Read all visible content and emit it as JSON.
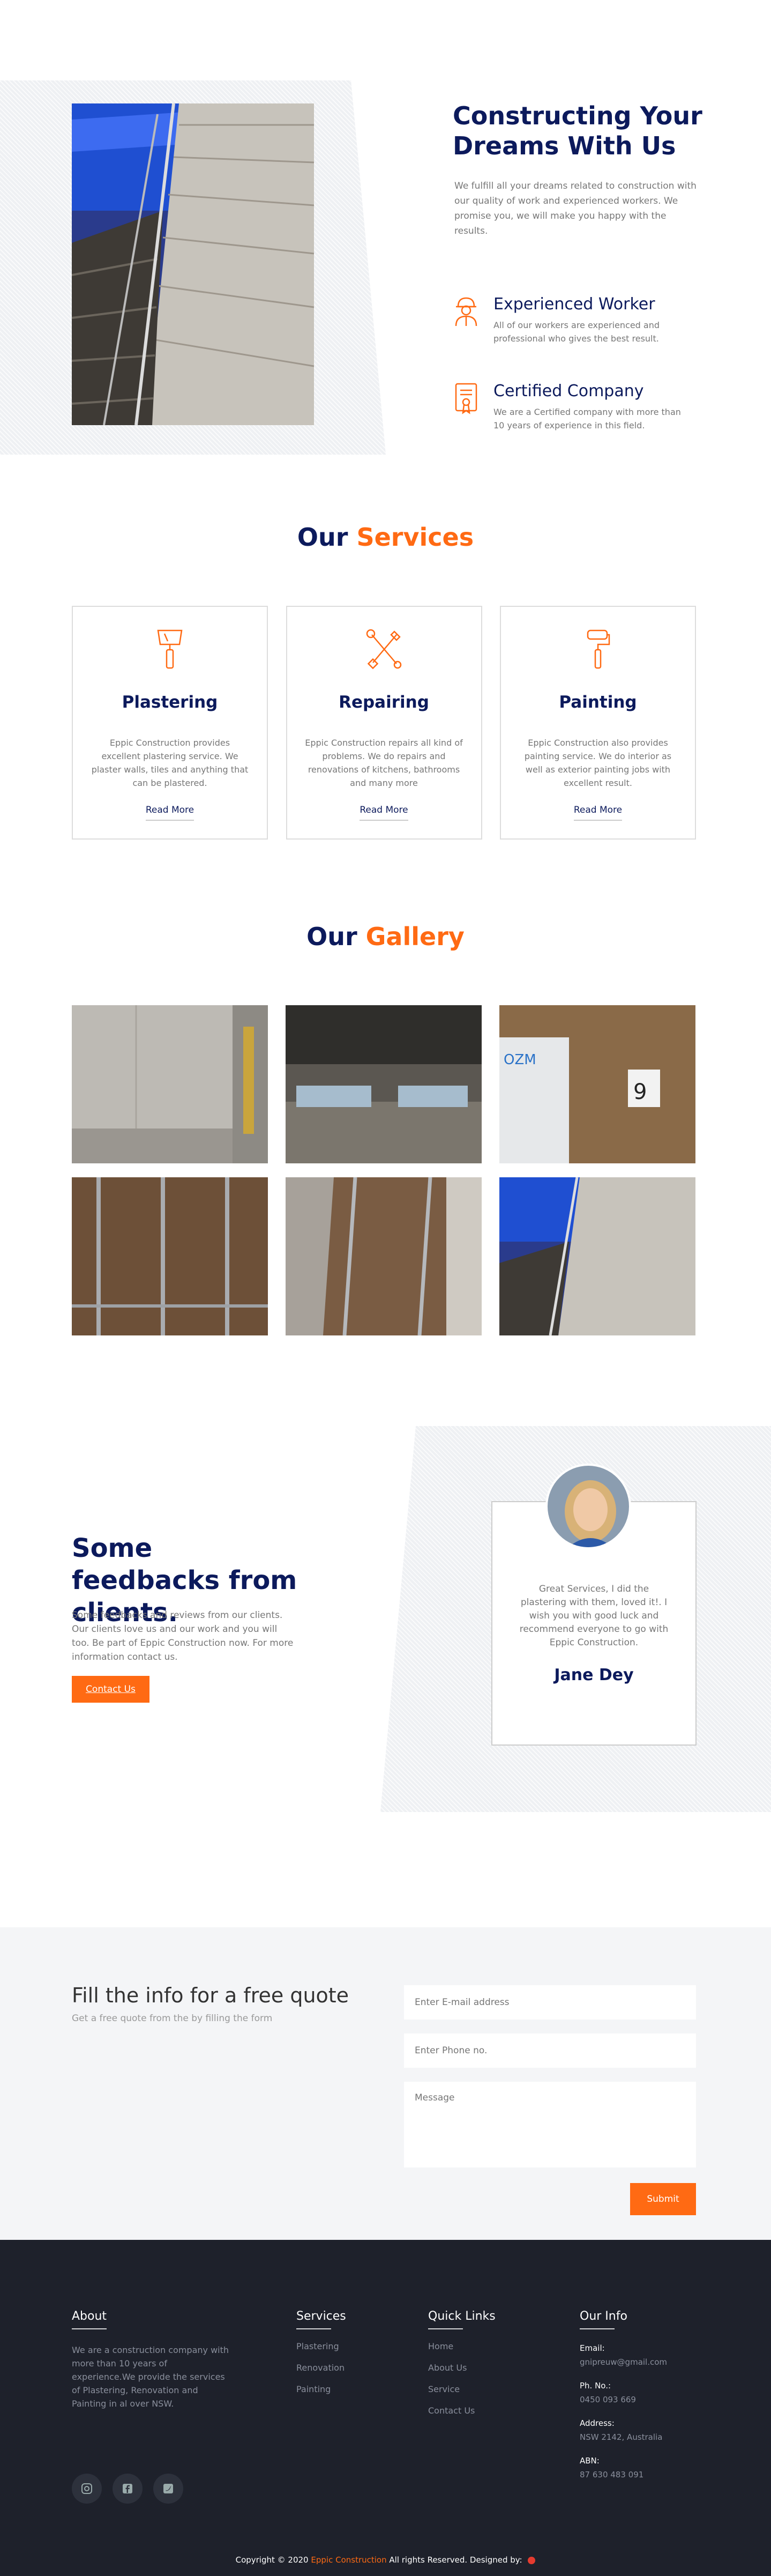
{
  "hero": {
    "title": "Constructing Your Dreams With Us",
    "text": "We fulfill all your dreams related to construction with our quality of work and experienced workers. We promise you, we will make you happy with the results.",
    "features": [
      {
        "icon": "worker-icon",
        "title": "Experienced Worker",
        "text": "All of our workers are experienced and professional who gives the best result."
      },
      {
        "icon": "certificate-icon",
        "title": "Certified Company",
        "text": "We are a Certified company with more than 10 years of experience in this field."
      }
    ]
  },
  "services": {
    "title_a": "Our",
    "title_b": "Services",
    "cards": [
      {
        "icon": "putty-knife-icon",
        "title": "Plastering",
        "text": "Eppic Construction provides excellent plastering service. We plaster walls, tiles and anything that can be plastered.",
        "link": "Read More"
      },
      {
        "icon": "tools-icon",
        "title": "Repairing",
        "text": "Eppic Construction repairs all kind of problems. We do repairs and renovations of kitchens, bathrooms and many more",
        "link": "Read More"
      },
      {
        "icon": "paint-roller-icon",
        "title": "Painting",
        "text": "Eppic Construction also provides painting service. We do interior as well as exterior painting jobs with excellent result.",
        "link": "Read More"
      }
    ]
  },
  "gallery": {
    "title_a": "Our",
    "title_b": "Gallery"
  },
  "feedback": {
    "title": "Some feedbacks from clients.",
    "text": "Some feedbacks and reviews from our clients. Our clients love us and our work and you will too. Be part of Eppic Construction now. For more information contact us.",
    "button": "Contact Us",
    "quote": "Great Services, I did the plastering with them, loved it!. I wish you with good luck and recommend everyone to go with Eppic Construction.",
    "author": "Jane Dey"
  },
  "quote": {
    "title": "Fill the info for a free quote",
    "subtitle": "Get a free quote from the by filling the form",
    "email_placeholder": "Enter E-mail address",
    "phone_placeholder": "Enter Phone no.",
    "message_placeholder": "Message",
    "submit": "Submit"
  },
  "footer": {
    "about_title": "About",
    "about_text": "We are a construction company with more than 10 years of experience.We provide the services of Plastering, Renovation and Painting in al over NSW.",
    "services_title": "Services",
    "services": [
      "Plastering",
      "Renovation",
      "Painting"
    ],
    "links_title": "Quick Links",
    "links": [
      "Home",
      "About Us",
      "Service",
      "Contact Us"
    ],
    "info_title": "Our Info",
    "info": [
      {
        "label": "Email:",
        "value": "gnipreuw@gmail.com"
      },
      {
        "label": "Ph. No.:",
        "value": "0450 093 669"
      },
      {
        "label": "Address:",
        "value": "NSW 2142, Australia"
      },
      {
        "label": "ABN:",
        "value": "87 630 483 091"
      }
    ],
    "copy_a": "Copyright © 2020",
    "copy_brand": "Eppic Construction",
    "copy_b": "All rights Reserved. Designed by:"
  },
  "colors": {
    "accent": "#ff6a13",
    "navy": "#0c1a5c",
    "footer": "#1e212b"
  }
}
